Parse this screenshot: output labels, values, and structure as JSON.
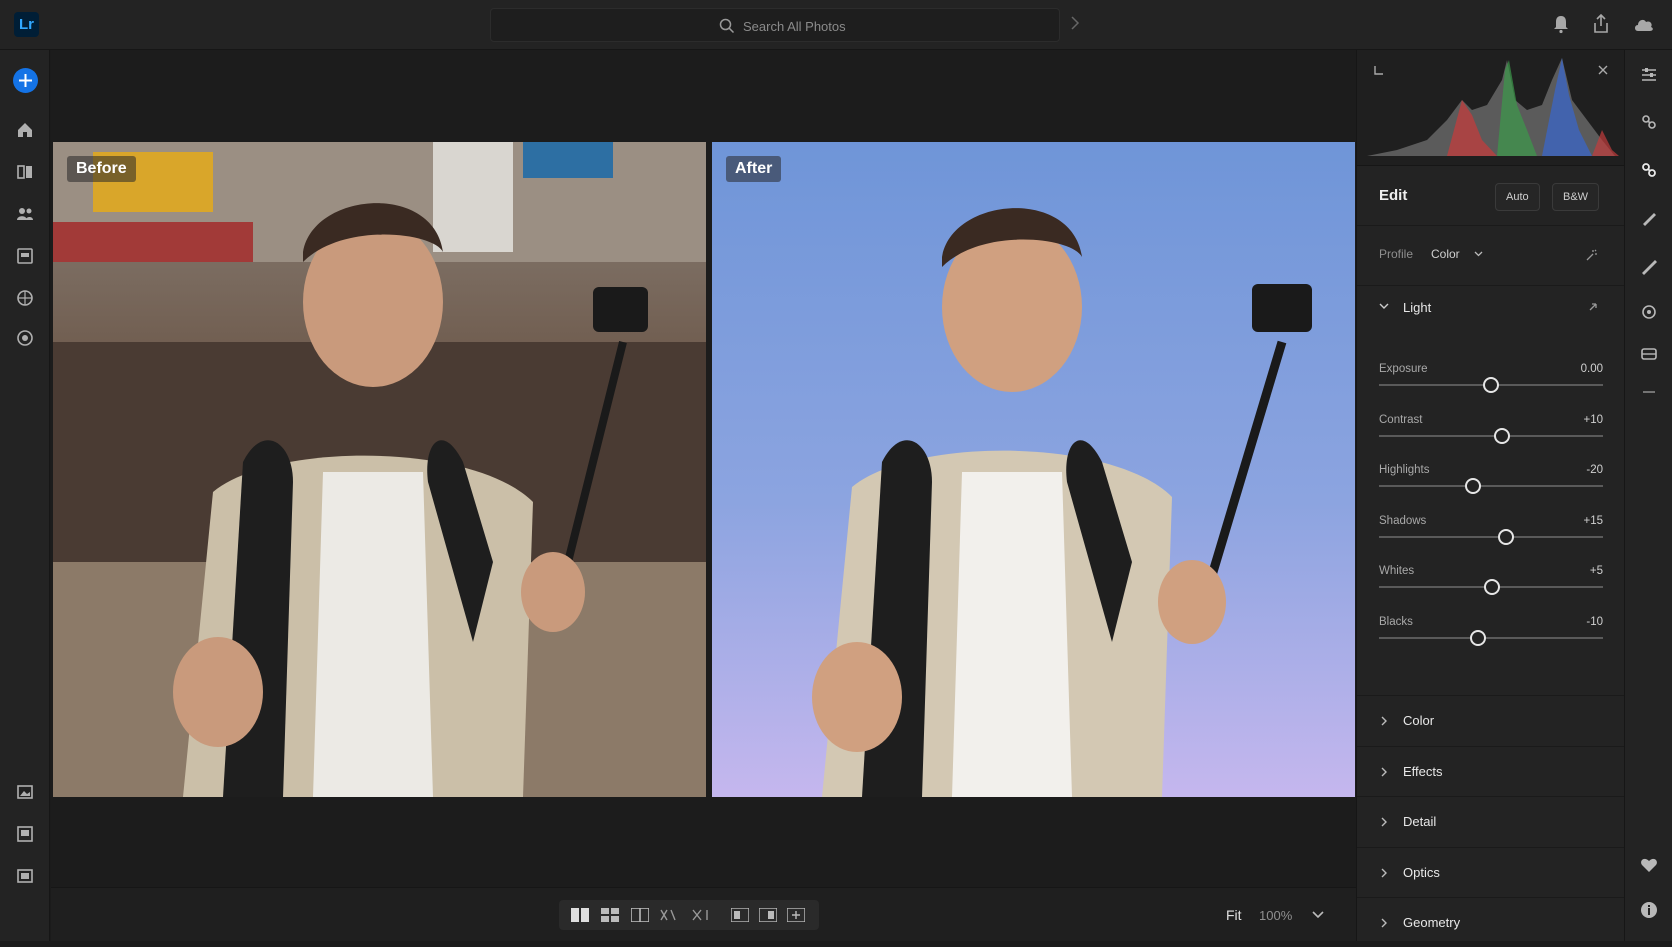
{
  "app": {
    "logo_text": "Lr",
    "accent": "#31a8ff"
  },
  "search": {
    "placeholder": "Search All Photos"
  },
  "photos": {
    "before_label": "Before",
    "after_label": "After"
  },
  "edit": {
    "title": "Edit",
    "auto_label": "Auto",
    "bw_label": "B&W",
    "profile_label": "Profile",
    "profile_value": "Color",
    "light": {
      "title": "Light",
      "sliders": [
        {
          "label": "Exposure",
          "value": "0.00",
          "level": 0.5
        },
        {
          "label": "Contrast",
          "value": "+10",
          "level": 0.55
        },
        {
          "label": "Highlights",
          "value": "-20",
          "level": 0.42
        },
        {
          "label": "Shadows",
          "value": "+15",
          "level": 0.565
        },
        {
          "label": "Whites",
          "value": "+5",
          "level": 0.505
        },
        {
          "label": "Blacks",
          "value": "-10",
          "level": 0.44
        }
      ]
    },
    "sections": [
      "Color",
      "Effects",
      "Detail",
      "Optics",
      "Geometry"
    ]
  },
  "bottom": {
    "fit_label": "Fit",
    "zoom_label": "100%"
  }
}
